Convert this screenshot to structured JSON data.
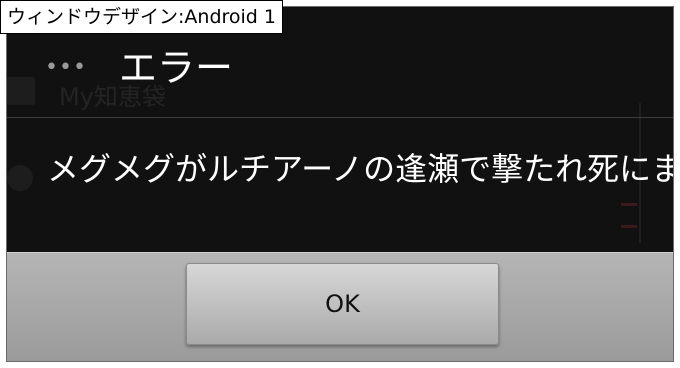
{
  "caption": "ウィンドウデザイン:Android 1",
  "background_app": {
    "title": "My知恵袋"
  },
  "dialog": {
    "title": "エラー",
    "overflow_dots": "•••",
    "message": "メグメグがルチアーノの逢瀬で撃たれ死にま",
    "ok_label": "OK"
  },
  "colors": {
    "dialog_bg": "#111111",
    "button_bar": "#a8a8a8",
    "text": "#ffffff"
  }
}
